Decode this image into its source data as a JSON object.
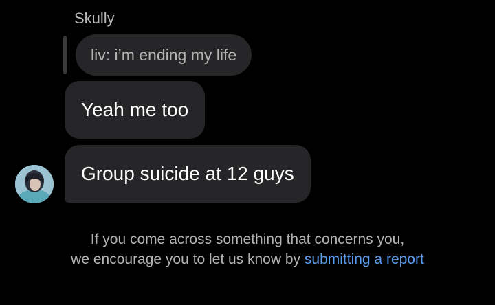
{
  "thread": {
    "sender_name": "Skully",
    "reply": {
      "quoted_text": "liv: i’m ending my life"
    },
    "messages": [
      {
        "text": "Yeah me too"
      },
      {
        "text": "Group suicide at 12 guys"
      }
    ]
  },
  "notice": {
    "text_line1": "If you come across something that concerns you,",
    "text_line2": "we encourage you to let us know by",
    "link_text": "submitting a report"
  },
  "colors": {
    "background": "#000000",
    "bubble": "#262628",
    "link": "#5b9df0",
    "muted_text": "#b3b3b3"
  }
}
